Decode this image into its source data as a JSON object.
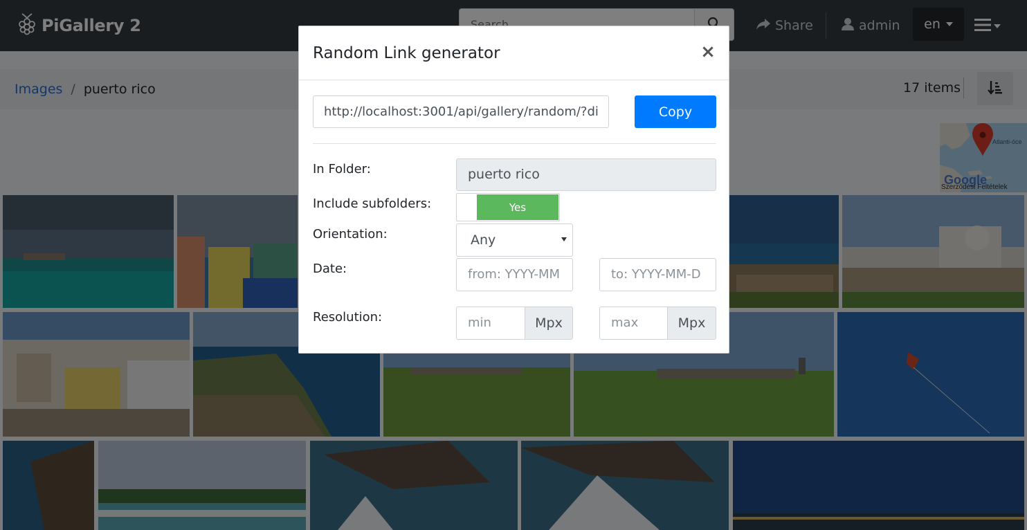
{
  "app": {
    "brand": "PiGallery 2"
  },
  "navbar": {
    "search_placeholder": "Search",
    "share_label": "Share",
    "user_label": "admin",
    "language": "en"
  },
  "breadcrumb": {
    "root": "Images",
    "separator": "/",
    "current": "puerto rico"
  },
  "gallery": {
    "items_count": "17 items",
    "map_caption": "Szerződési Feltételek"
  },
  "modal": {
    "title": "Random Link generator",
    "close": "×",
    "link_value": "http://localhost:3001/api/gallery/random/?di",
    "copy_label": "Copy",
    "in_folder_label": "In Folder:",
    "folder_value": "puerto rico",
    "include_subfolders_label": "Include subfolders:",
    "include_subfolders_value": "Yes",
    "orientation_label": "Orientation:",
    "orientation_value": "Any",
    "date_label": "Date:",
    "date_from_placeholder": "from: YYYY-MM",
    "date_to_placeholder": "to: YYYY-MM-D",
    "resolution_label": "Resolution:",
    "res_min_placeholder": "min",
    "res_max_placeholder": "max",
    "mpx_unit": "Mpx"
  },
  "colors": {
    "navbar_bg": "#343a40",
    "primary": "#007bff",
    "toggle_on": "#5cb85c",
    "link": "#2a6fd6"
  }
}
